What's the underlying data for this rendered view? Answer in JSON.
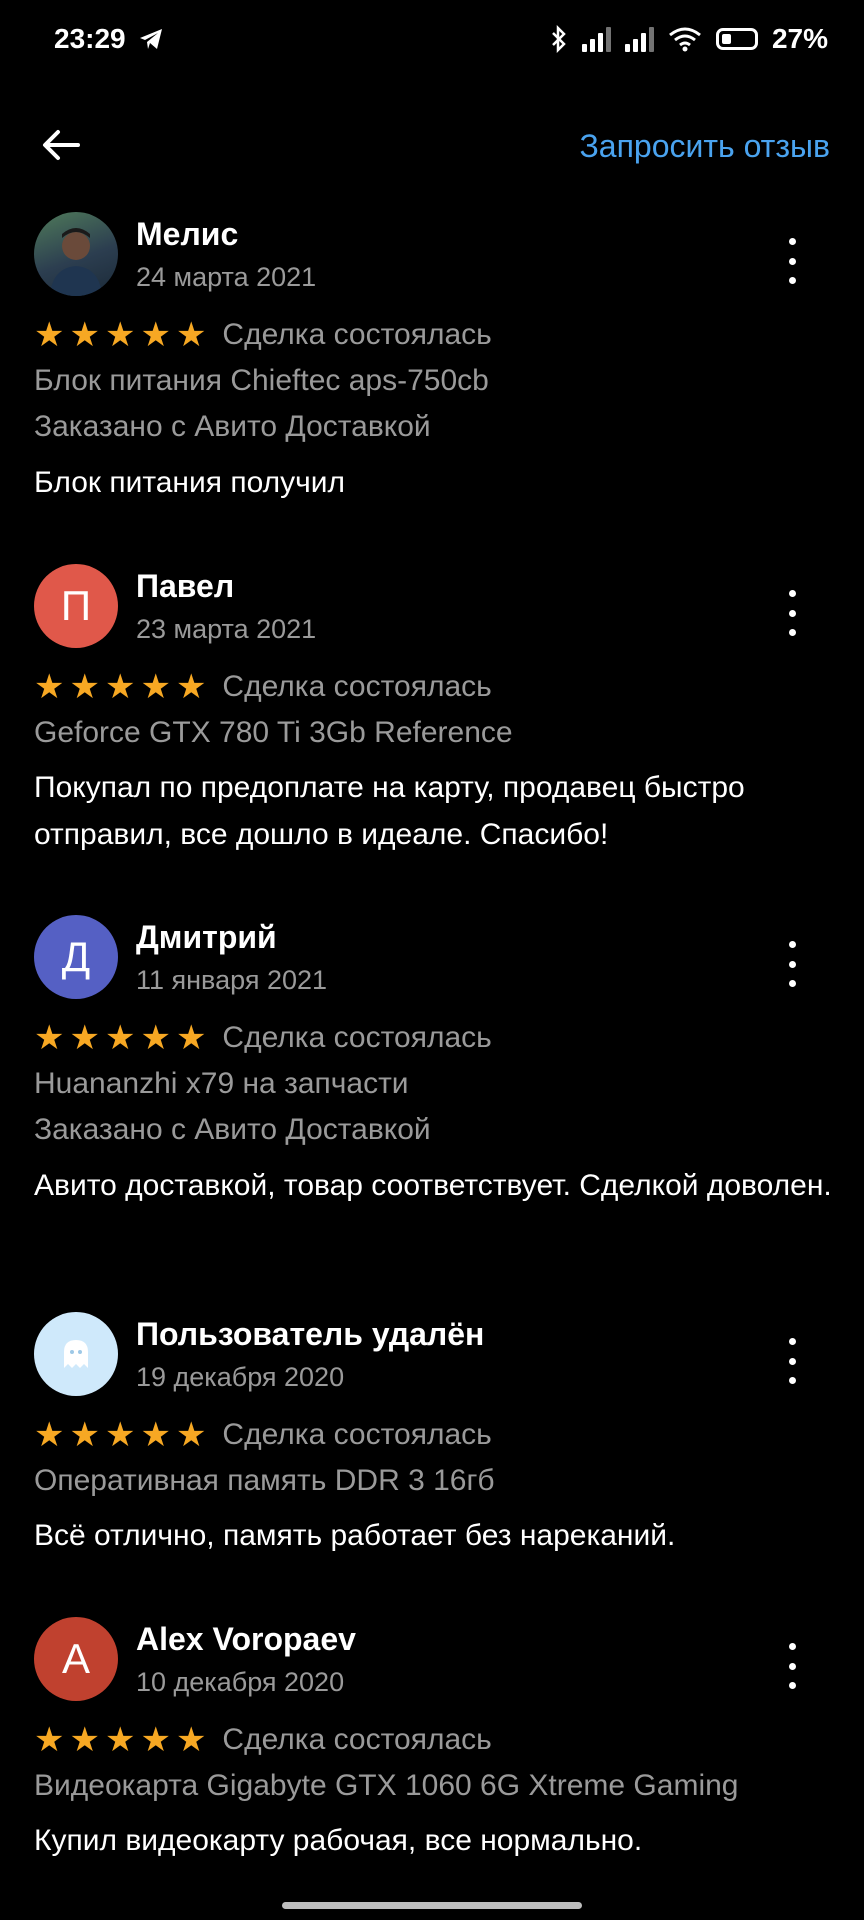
{
  "status_bar": {
    "time": "23:29",
    "battery": "27%"
  },
  "header": {
    "request_review": "Запросить отзыв"
  },
  "reviews": [
    {
      "name": "Мелис",
      "date": "24 марта 2021",
      "status": "Сделка состоялась",
      "rating": 5,
      "item": "Блок питания Chieftec aps-750cb",
      "delivery": "Заказано с Авито Доставкой",
      "text": "Блок питания получил",
      "avatar_letter": "",
      "avatar_color": "#3b5a6e"
    },
    {
      "name": "Павел",
      "date": "23 марта 2021",
      "status": "Сделка состоялась",
      "rating": 5,
      "item": "Geforce GTX 780 Ti 3Gb Reference",
      "delivery": "",
      "text": "Покупал по предоплате на карту, продавец быстро отправил, все дошло в идеале. Спасибо!",
      "avatar_letter": "П",
      "avatar_color": "#e0584a"
    },
    {
      "name": "Дмитрий",
      "date": "11 января 2021",
      "status": "Сделка состоялась",
      "rating": 5,
      "item": "Huananzhi x79 на запчасти",
      "delivery": "Заказано с Авито Доставкой",
      "text": "Авито доставкой, товар соответствует. Сделкой доволен.",
      "avatar_letter": "Д",
      "avatar_color": "#5560c4"
    },
    {
      "name": "Пользователь удалён",
      "date": "19 декабря 2020",
      "status": "Сделка состоялась",
      "rating": 5,
      "item": "Оперативная память DDR 3 16гб",
      "delivery": "",
      "text": "Всё отлично, память работает без нареканий.",
      "avatar_letter": "",
      "avatar_color": "#cfe9fb"
    },
    {
      "name": "Alex Voropaev",
      "date": "10 декабря 2020",
      "status": "Сделка состоялась",
      "rating": 5,
      "item": "Видеокарта Gigabyte GTX 1060 6G Xtreme Gaming",
      "delivery": "",
      "text": "Купил видеокарту рабочая, все нормально.",
      "avatar_letter": "A",
      "avatar_color": "#c0412f"
    }
  ],
  "colors": {
    "accent": "#4aa3ef",
    "star": "#f7a823",
    "secondary_text": "#9a9a9a",
    "background": "#000000"
  },
  "icons": {
    "back": "arrow-left-icon",
    "more": "more-vertical-icon",
    "star": "star-icon",
    "telegram": "telegram-icon",
    "deleted_user": "ghost-icon"
  }
}
